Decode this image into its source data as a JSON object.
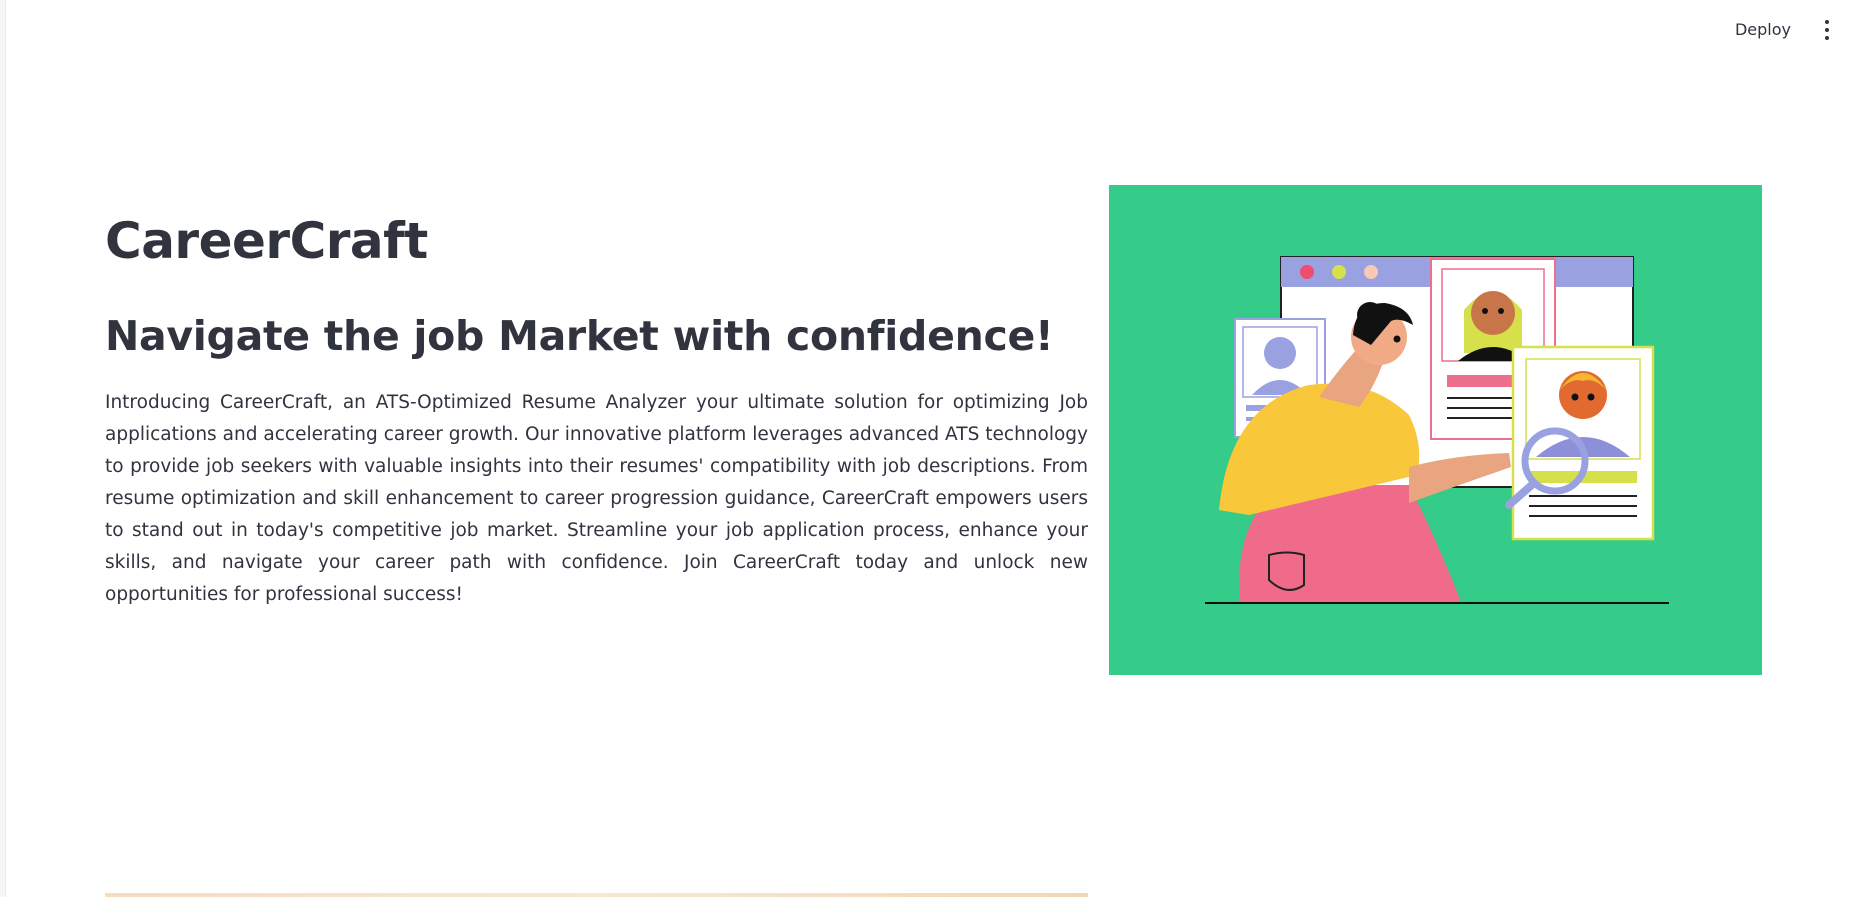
{
  "toolbar": {
    "deploy_label": "Deploy",
    "menu_icon": "more-vertical-icon"
  },
  "hero": {
    "title": "CareerCraft",
    "tagline": "Navigate the job Market with confidence!",
    "intro": "Introducing CareerCraft, an ATS-Optimized Resume Analyzer your ultimate solution for optimizing Job applications and accelerating career growth. Our innovative platform leverages advanced ATS technology to provide job seekers with valuable insights into their resumes' compatibility with job descriptions. From resume optimization and skill enhancement to career progression guidance, CareerCraft empowers users to stand out in today's competitive job market. Streamline your job application process, enhance your skills, and navigate your career path with confidence. Join CareerCraft today and unlock new opportunities for professional success!"
  },
  "colors": {
    "illustration_background": "#35cc8a",
    "text": "#31333f"
  }
}
